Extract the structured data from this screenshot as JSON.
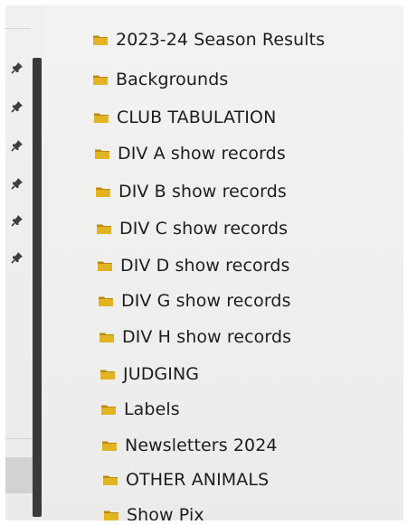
{
  "navigation_pane": {
    "pins": [
      {
        "icon": "pin-icon"
      },
      {
        "icon": "pin-icon"
      },
      {
        "icon": "pin-icon"
      },
      {
        "icon": "pin-icon"
      },
      {
        "icon": "pin-icon"
      },
      {
        "icon": "pin-icon"
      }
    ]
  },
  "folders": [
    {
      "name": "2023-24 Season Results",
      "icon": "folder-icon"
    },
    {
      "name": "Backgrounds",
      "icon": "folder-icon"
    },
    {
      "name": "CLUB TABULATION",
      "icon": "folder-icon"
    },
    {
      "name": "DIV A show records",
      "icon": "folder-icon"
    },
    {
      "name": "DIV B show records",
      "icon": "folder-icon"
    },
    {
      "name": "DIV C show records",
      "icon": "folder-icon"
    },
    {
      "name": "DIV D show records",
      "icon": "folder-icon"
    },
    {
      "name": "DIV G show records",
      "icon": "folder-icon"
    },
    {
      "name": "DIV H show records",
      "icon": "folder-icon"
    },
    {
      "name": "JUDGING",
      "icon": "folder-icon"
    },
    {
      "name": "Labels",
      "icon": "folder-icon"
    },
    {
      "name": "Newsletters 2024",
      "icon": "folder-icon"
    },
    {
      "name": "OTHER ANIMALS",
      "icon": "folder-icon"
    },
    {
      "name": "Show Pix",
      "icon": "folder-icon"
    }
  ],
  "colors": {
    "folder_yellow": "#e3b422",
    "folder_dark": "#b98a10",
    "text": "#1d1d1d",
    "scrollbar": "#3a3a3a"
  }
}
